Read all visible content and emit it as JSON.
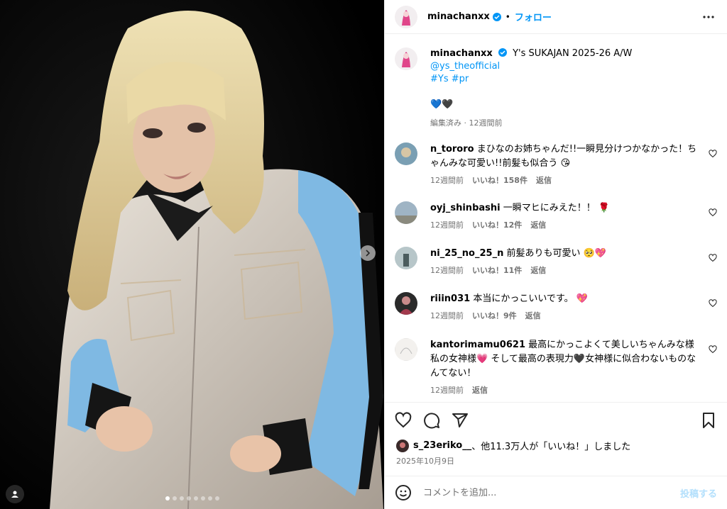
{
  "post": {
    "username": "minachanxx",
    "follow_label": "フォロー",
    "bullet": "•",
    "caption_text": "Y's SUKAJAN 2025-26 A/W",
    "mention": "@ys_theofficial",
    "hashtags": "#Ys #pr",
    "caption_hearts": "💙🖤",
    "edited_meta": "編集済み · 12週間前"
  },
  "comments": [
    {
      "user": "n_tororo",
      "text": "まひなのお姉ちゃんだ!!一瞬見分けつかなかった！ちゃんみな可愛い!!前髪も似合う",
      "emoji": "😘",
      "time": "12週間前",
      "likes": "いいね！158件",
      "reply": "返信"
    },
    {
      "user": "oyj_shinbashi",
      "text": "一瞬マヒにみえた！！",
      "emoji": "🌹",
      "time": "12週間前",
      "likes": "いいね！12件",
      "reply": "返信"
    },
    {
      "user": "ni_25_no_25_n",
      "text": "前髪ありも可愛い",
      "emoji": "🥺💖",
      "time": "12週間前",
      "likes": "いいね！11件",
      "reply": "返信"
    },
    {
      "user": "riiin031",
      "text": "本当にかっこいいです。",
      "emoji": "💖",
      "time": "12週間前",
      "likes": "いいね！9件",
      "reply": "返信"
    },
    {
      "user": "kantorimamu0621",
      "text": "最高にかっこよくて美しいちゃんみな様私の女神様💗 そして最高の表現力🖤女神様に似合わないものなんてない！",
      "emoji": "",
      "time": "12週間前",
      "likes": "",
      "reply": "返信"
    }
  ],
  "likes_summary": {
    "user": "s_23eriko__",
    "rest": "、他11.3万人が「いいね！」しました"
  },
  "post_date": "2025年10月9日",
  "composer": {
    "placeholder": "コメントを追加...",
    "post_label": "投稿する"
  },
  "colors": {
    "accent": "#0095f6",
    "link": "#00376b",
    "muted": "#737373",
    "post_disabled": "#b2dffc",
    "jacket_sleeve": "#7fb9e3"
  },
  "icons": [
    "verified-badge-icon",
    "more-options-icon",
    "heart-icon",
    "comment-icon",
    "share-icon",
    "bookmark-icon",
    "emoji-icon",
    "chevron-right-icon",
    "user-tag-icon"
  ],
  "carousel": {
    "total": 8,
    "current": 1
  }
}
